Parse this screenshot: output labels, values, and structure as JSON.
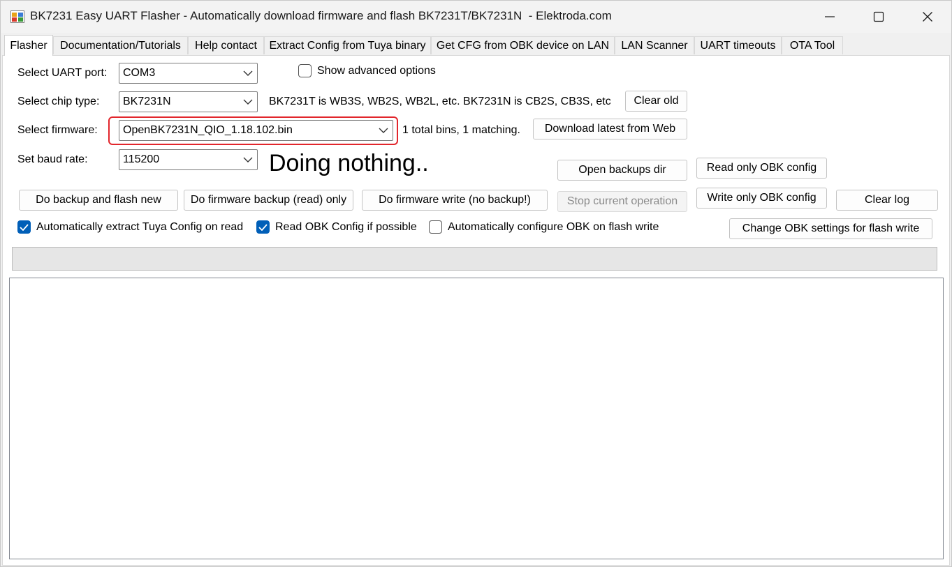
{
  "window": {
    "title": "BK7231 Easy UART Flasher - Automatically download firmware and flash BK7231T/BK7231N  - Elektroda.com",
    "icon": "app-icon",
    "controls": {
      "minimize": "minimize-icon",
      "maximize": "maximize-icon",
      "close": "close-icon"
    }
  },
  "tabs": [
    {
      "label": "Flasher",
      "active": true
    },
    {
      "label": "Documentation/Tutorials"
    },
    {
      "label": "Help contact"
    },
    {
      "label": "Extract Config from Tuya binary"
    },
    {
      "label": "Get CFG from OBK device on LAN"
    },
    {
      "label": "LAN Scanner"
    },
    {
      "label": "UART timeouts"
    },
    {
      "label": "OTA Tool"
    }
  ],
  "flasher": {
    "uart_port": {
      "label": "Select UART port:",
      "value": "COM3"
    },
    "show_advanced": {
      "label": "Show advanced options",
      "checked": false
    },
    "chip_type": {
      "label": "Select chip type:",
      "value": "BK7231N"
    },
    "chip_info": "BK7231T is WB3S, WB2S, WB2L, etc. BK7231N is CB2S, CB3S, etc",
    "clear_old": "Clear old",
    "firmware": {
      "label": "Select firmware:",
      "value": "OpenBK7231N_QIO_1.18.102.bin"
    },
    "bins_info": "1 total bins, 1 matching.",
    "download_latest": "Download latest from Web",
    "baud_rate": {
      "label": "Set baud rate:",
      "value": "115200"
    },
    "status_text": "Doing nothing..",
    "open_backups_dir": "Open backups dir",
    "read_only_obk_config": "Read only OBK config",
    "backup_and_flash": "Do backup and flash new",
    "firmware_backup_read_only": "Do firmware backup (read) only",
    "firmware_write_no_backup": "Do firmware write (no backup!)",
    "stop_current_operation": "Stop current operation",
    "write_only_obk_config": "Write only OBK config",
    "clear_log": "Clear log",
    "auto_extract_tuya": {
      "label": "Automatically extract Tuya Config on read",
      "checked": true
    },
    "read_obk_config": {
      "label": "Read OBK Config if possible",
      "checked": true
    },
    "auto_configure_obk": {
      "label": "Automatically configure OBK on flash write",
      "checked": false
    },
    "change_obk_settings": "Change OBK settings for flash write",
    "progress": 0
  },
  "colors": {
    "highlight": "#e2262c",
    "checkbox_checked": "#005fb8",
    "progress_track": "#e6e6e6"
  }
}
